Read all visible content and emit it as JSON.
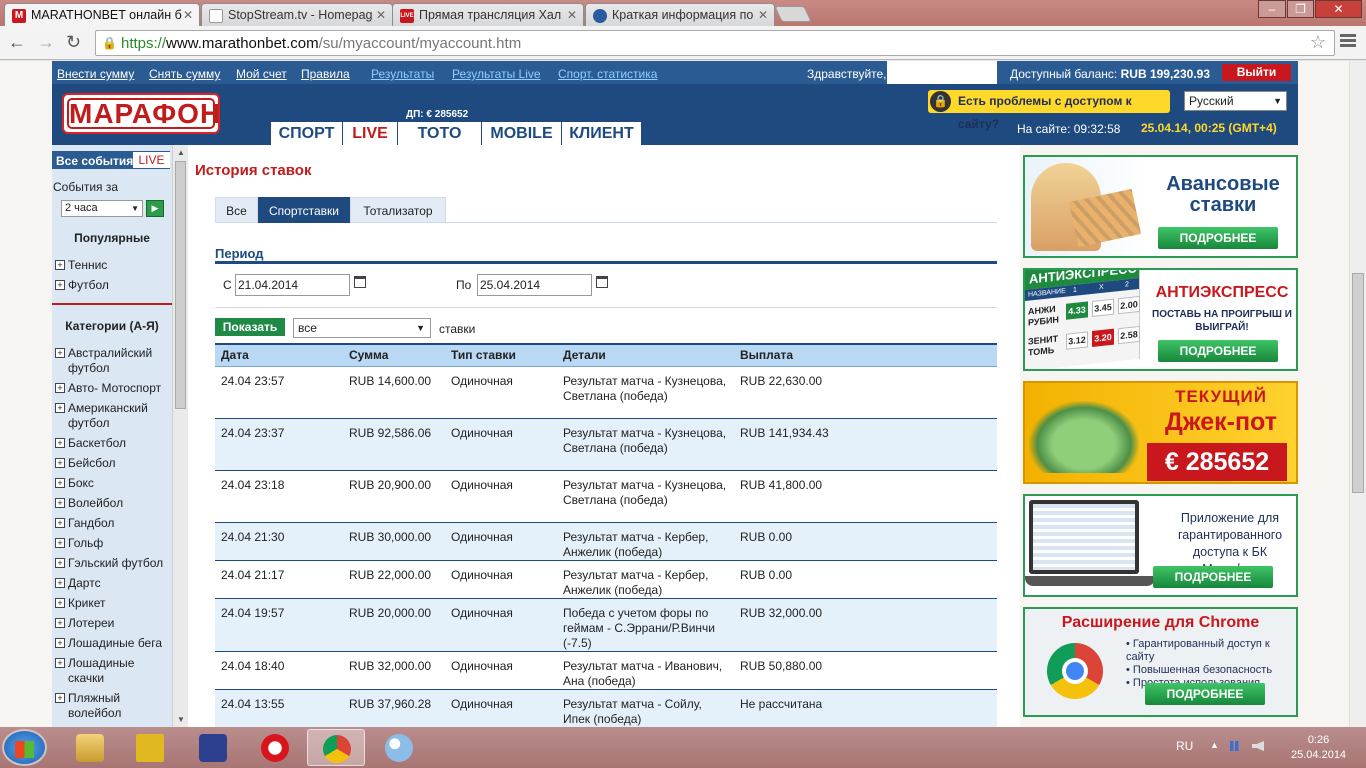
{
  "browser": {
    "tabs": [
      {
        "label": "MARATHONBET онлайн б",
        "favicon": "M",
        "color": "#c8181e"
      },
      {
        "label": "StopStream.tv - Homepag",
        "favicon": "",
        "color": "#ffffff"
      },
      {
        "label": "Прямая трансляция Хал",
        "favicon": "LIVE",
        "color": "#c8181e"
      },
      {
        "label": "Краткая информация по",
        "favicon": "",
        "color": "#2b5aa0"
      }
    ],
    "url_scheme": "https://",
    "url_host": "www.marathonbet.com",
    "url_path": "/su/myaccount/myaccount.htm"
  },
  "topnav": {
    "links": [
      "Внести сумму",
      "Снять сумму",
      "Мой счет",
      "Правила",
      "Результаты",
      "Результаты Live",
      "Спорт. статистика"
    ],
    "greeting": "Здравствуйте,",
    "balance_label": "Доступный баланс:",
    "balance_value": "RUB 199,230.93",
    "logout": "Выйти"
  },
  "header": {
    "logo": "МАРАФОН",
    "jackpot_small": "ДП: € 285652",
    "main_tabs": [
      "СПОРТ",
      "LIVE",
      "TOTO",
      "MOBILE",
      "КЛИЕНТ"
    ],
    "access_problem": "Есть проблемы с доступом к сайту?",
    "language": "Русский",
    "online_label": "На сайте: 09:32:58",
    "datetime": "25.04.14, 00:25 (GMT+4)"
  },
  "sidebar": {
    "tab_all": "Все события",
    "tab_live": "LIVE",
    "events_for": "События за",
    "period": "2 часа",
    "popular_title": "Популярные",
    "popular": [
      "Теннис",
      "Футбол"
    ],
    "categories_title": "Категории (А-Я)",
    "categories": [
      "Австралийский футбол",
      "Авто- Мотоспорт",
      "Американский футбол",
      "Баскетбол",
      "Бейсбол",
      "Бокс",
      "Волейбол",
      "Гандбол",
      "Гольф",
      "Гэльский футбол",
      "Дартс",
      "Крикет",
      "Лотереи",
      "Лошадиные бега",
      "Лошадиные скачки",
      "Пляжный волейбол"
    ]
  },
  "main": {
    "title": "История ставок",
    "filter_tabs": [
      "Все",
      "Спортставки",
      "Тотализатор"
    ],
    "period_label": "Период",
    "from_label": "С",
    "from_value": "21.04.2014",
    "to_label": "По",
    "to_value": "25.04.2014",
    "show_button": "Показать",
    "type_select": "все",
    "type_suffix": "ставки",
    "columns": [
      "Дата",
      "Сумма",
      "Тип ставки",
      "Детали",
      "Выплата"
    ],
    "rows": [
      {
        "date": "24.04 23:57",
        "sum": "RUB 14,600.00",
        "type": "Одиночная",
        "details": "Результат матча - Кузнецова, Светлана (победа)",
        "payout": "RUB 22,630.00"
      },
      {
        "date": "24.04 23:37",
        "sum": "RUB 92,586.06",
        "type": "Одиночная",
        "details": "Результат матча - Кузнецова, Светлана (победа)",
        "payout": "RUB 141,934.43"
      },
      {
        "date": "24.04 23:18",
        "sum": "RUB 20,900.00",
        "type": "Одиночная",
        "details": "Результат матча - Кузнецова, Светлана (победа)",
        "payout": "RUB 41,800.00"
      },
      {
        "date": "24.04 21:30",
        "sum": "RUB 30,000.00",
        "type": "Одиночная",
        "details": "Результат матча - Кербер, Анжелик (победа)",
        "payout": "RUB 0.00"
      },
      {
        "date": "24.04 21:17",
        "sum": "RUB 22,000.00",
        "type": "Одиночная",
        "details": "Результат матча - Кербер, Анжелик (победа)",
        "payout": "RUB 0.00"
      },
      {
        "date": "24.04 19:57",
        "sum": "RUB 20,000.00",
        "type": "Одиночная",
        "details": "Победа с учетом форы по геймам - С.Эррани/Р.Винчи (-7.5)",
        "payout": "RUB 32,000.00"
      },
      {
        "date": "24.04 18:40",
        "sum": "RUB 32,000.00",
        "type": "Одиночная",
        "details": "Результат матча - Иванович, Ана (победа)",
        "payout": "RUB 50,880.00"
      },
      {
        "date": "24.04 13:55",
        "sum": "RUB 37,960.28",
        "type": "Одиночная",
        "details": "Результат матча - Сойлу, Ипек (победа)",
        "payout": "Не рассчитана"
      }
    ]
  },
  "banners": {
    "advance": {
      "title": "Авансовые ставки",
      "button": "ПОДРОБНЕЕ"
    },
    "antiexpress": {
      "title": "АНТИЭКСПРЕСС",
      "text": "ПОСТАВЬ НА ПРОИГРЫШ И ВЫИГРАЙ!",
      "button": "ПОДРОБНЕЕ",
      "table_title": "АНТИЭКСПРЕСС",
      "table_head": [
        "НАЗВАНИЕ",
        "1",
        "X",
        "2"
      ],
      "rows": [
        {
          "name": "АНЖИ РУБИН",
          "o1": "4.33",
          "ox": "3.45",
          "o2": "2.00"
        },
        {
          "name": "ЗЕНИТ ТОМЬ",
          "o1": "3.12",
          "ox": "3.20",
          "o2": "2.58"
        }
      ]
    },
    "jackpot": {
      "line1": "ТЕКУЩИЙ",
      "line2": "Джек-пот",
      "amount": "€ 285652"
    },
    "app": {
      "text": "Приложение для гарантированного доступа к БК «Марафон»",
      "button": "ПОДРОБНЕЕ"
    },
    "chrome": {
      "title": "Расширение для Chrome",
      "bullets": [
        "Гарантированный доступ к сайту",
        "Повышенная безопасность",
        "Простота использования"
      ],
      "button": "ПОДРОБНЕЕ"
    }
  },
  "taskbar": {
    "lang": "RU",
    "time": "0:26",
    "date": "25.04.2014"
  }
}
